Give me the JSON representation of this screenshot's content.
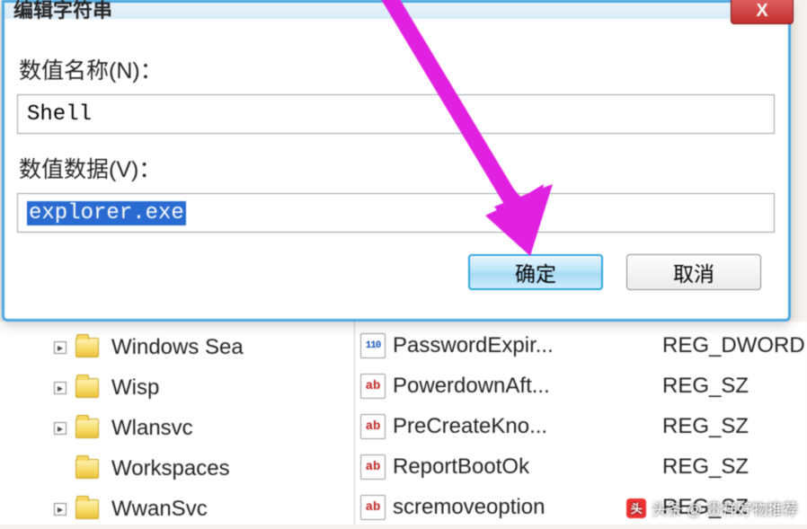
{
  "dialog": {
    "title": "编辑字符串",
    "name_label": "数值名称(N)：",
    "name_value": "Shell",
    "data_label": "数值数据(V)：",
    "data_value": "explorer.exe",
    "ok_label": "确定",
    "cancel_label": "取消",
    "close_label": "X"
  },
  "tree": {
    "items": [
      {
        "label": "Windows Sea"
      },
      {
        "label": "Wisp"
      },
      {
        "label": "Wlansvc"
      },
      {
        "label": "Workspaces"
      },
      {
        "label": "WwanSvc"
      }
    ]
  },
  "values": {
    "rows": [
      {
        "icon": "bin",
        "icon_text": "110",
        "name": "PasswordExpir...",
        "type": "REG_DWORD"
      },
      {
        "icon": "ab",
        "icon_text": "ab",
        "name": "PowerdownAft...",
        "type": "REG_SZ"
      },
      {
        "icon": "ab",
        "icon_text": "ab",
        "name": "PreCreateKno...",
        "type": "REG_SZ"
      },
      {
        "icon": "ab",
        "icon_text": "ab",
        "name": "ReportBootOk",
        "type": "REG_SZ"
      },
      {
        "icon": "ab",
        "icon_text": "ab",
        "name": "scremoveoption",
        "type": "REG_SZ"
      }
    ]
  },
  "watermark": {
    "text": "头条 @ 贵祥好物推荐",
    "logo": "头"
  }
}
